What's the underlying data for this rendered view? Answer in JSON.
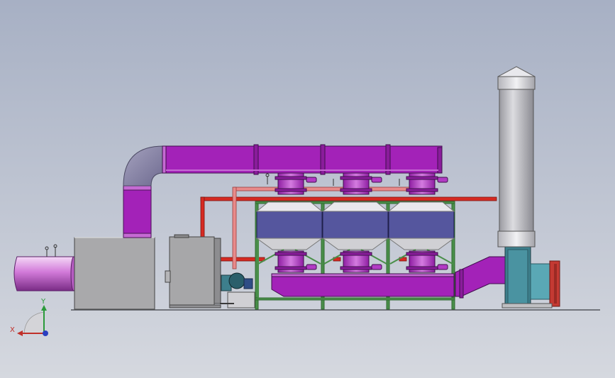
{
  "viewport": {
    "background_top": "#a7b0c4",
    "background_bottom": "#d5d8df"
  },
  "colors": {
    "duct_purple": "#a322b8",
    "duct_purple_light": "#c56ad3",
    "duct_elbow": "#8e8aab",
    "bed_blue": "#55569e",
    "pipe_red": "#d62a22",
    "pipe_pink": "#e88a8a",
    "frame_green": "#4a8f4a",
    "housing_gray": "#a8a8a8",
    "stack_gray": "#b8b8bb",
    "fan_teal": "#3d7f8c"
  },
  "triad": {
    "x_label": "X",
    "y_label": "Y",
    "x_color": "#c0302a",
    "y_color": "#2a9a3a",
    "z_color": "#2a3fc0"
  }
}
